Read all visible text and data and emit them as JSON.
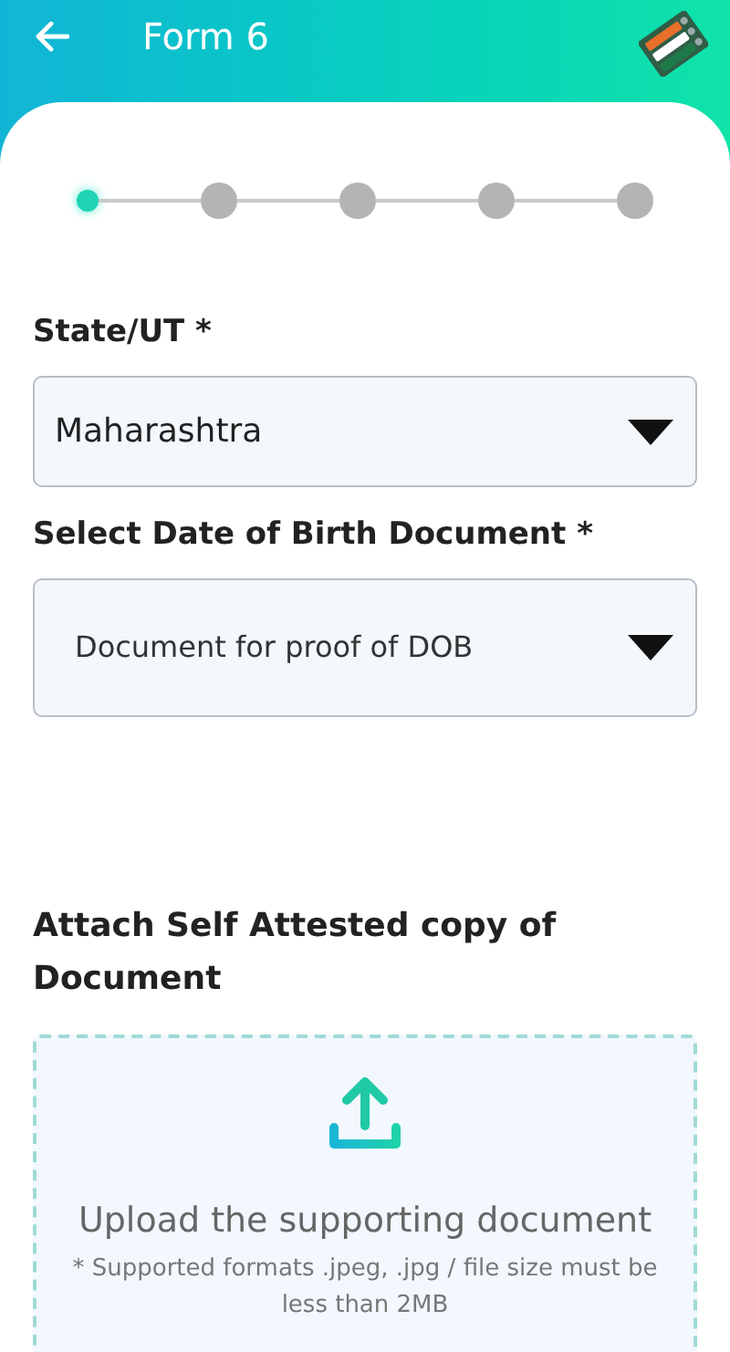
{
  "header": {
    "title": "Form 6"
  },
  "steps": [
    {
      "selected": true
    },
    {
      "selected": false
    },
    {
      "selected": false
    },
    {
      "selected": false
    },
    {
      "selected": false
    }
  ],
  "fields": [
    {
      "label": "State/UT *",
      "value": "Maharashtra",
      "kind": "value"
    },
    {
      "label": "Select Date of Birth Document *",
      "placeholder": "Document for proof of DOB",
      "kind": "placeholder"
    }
  ],
  "attachment": {
    "label": "Attach Self Attested copy of Document",
    "prompt": "Upload the supporting document",
    "note": "* Supported formats .jpeg, .jpg / file size must be less than 2MB"
  }
}
